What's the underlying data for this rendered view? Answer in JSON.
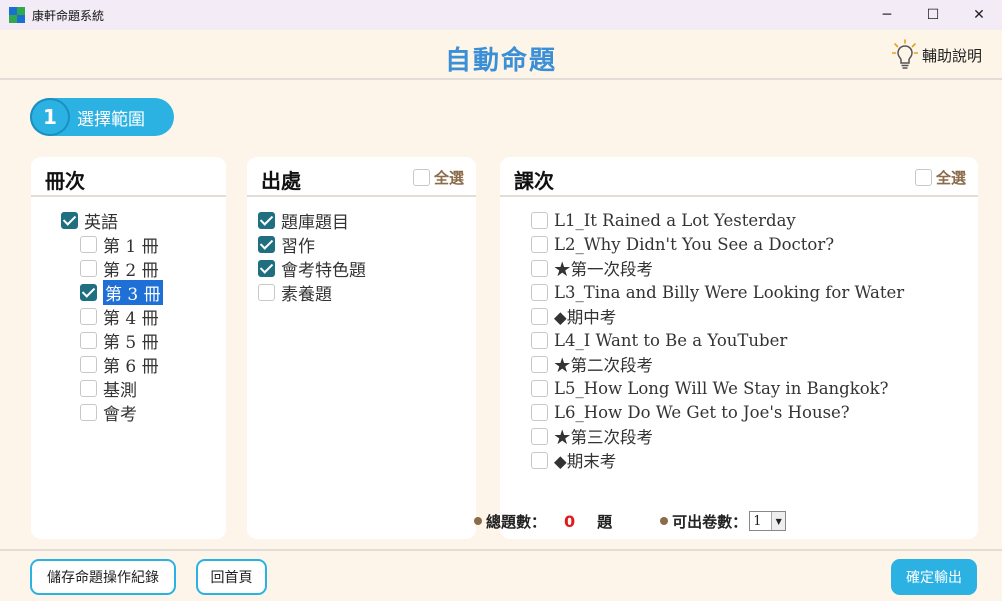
{
  "window": {
    "title": "康軒命題系統",
    "minimize": "─",
    "maximize": "☐",
    "close": "✕"
  },
  "header": {
    "title": "自動命題",
    "help_label": "輔助說明"
  },
  "step": {
    "number": "1",
    "label": "選擇範圍"
  },
  "volumes": {
    "title": "冊次",
    "root": {
      "label": "英語",
      "checked": true
    },
    "items": [
      {
        "label": "第 1 冊",
        "checked": false
      },
      {
        "label": "第 2 冊",
        "checked": false
      },
      {
        "label": "第 3 冊",
        "checked": true,
        "selected": true
      },
      {
        "label": "第 4 冊",
        "checked": false
      },
      {
        "label": "第 5 冊",
        "checked": false
      },
      {
        "label": "第 6 冊",
        "checked": false
      },
      {
        "label": "基測",
        "checked": false
      },
      {
        "label": "會考",
        "checked": false
      }
    ]
  },
  "sources": {
    "title": "出處",
    "select_all": "全選",
    "items": [
      {
        "label": "題庫題目",
        "checked": true
      },
      {
        "label": "習作",
        "checked": true
      },
      {
        "label": "會考特色題",
        "checked": true
      },
      {
        "label": "素養題",
        "checked": false
      }
    ]
  },
  "lessons": {
    "title": "課次",
    "select_all": "全選",
    "items": [
      {
        "label": "L1_It Rained a Lot Yesterday",
        "checked": false
      },
      {
        "label": "L2_Why Didn't You See a Doctor?",
        "checked": false
      },
      {
        "label": "★第一次段考",
        "checked": false
      },
      {
        "label": "L3_Tina and Billy Were Looking for Water",
        "checked": false
      },
      {
        "label": "◆期中考",
        "checked": false
      },
      {
        "label": "L4_I Want to Be a YouTuber",
        "checked": false
      },
      {
        "label": "★第二次段考",
        "checked": false
      },
      {
        "label": "L5_How Long Will We Stay in Bangkok?",
        "checked": false
      },
      {
        "label": "L6_How Do We Get to Joe's House?",
        "checked": false
      },
      {
        "label": "★第三次段考",
        "checked": false
      },
      {
        "label": "◆期末考",
        "checked": false
      }
    ]
  },
  "summary": {
    "total_label": "總題數：",
    "total_value": "0",
    "total_unit": "題",
    "copies_label": "可出卷數：",
    "copies_value": "1",
    "copies_arrow": "▼"
  },
  "footer": {
    "save_label": "儲存命題操作紀錄",
    "home_label": "回首頁",
    "confirm_label": "確定輸出"
  },
  "colors": {
    "accent": "#2bb2e3",
    "title_blue": "#3a8fd6",
    "checkbox_checked": "#1f6f80",
    "total_red": "#e0191a"
  }
}
